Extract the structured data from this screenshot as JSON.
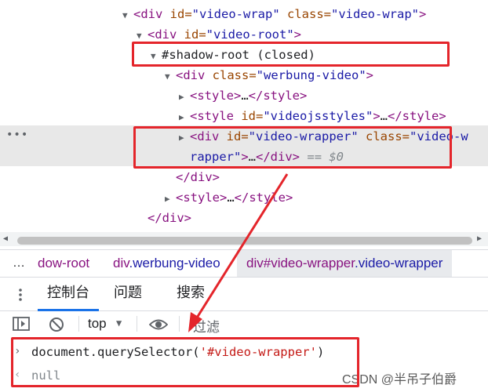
{
  "tree": {
    "l1": {
      "tag": "<div",
      "a1": "id=",
      "v1": "\"video-wrap\"",
      "a2": "class=",
      "v2": "\"video-wrap\"",
      "end": ">"
    },
    "l2": {
      "tag": "<div",
      "a1": "id=",
      "v1": "\"video-root\"",
      "end": ">"
    },
    "l3": {
      "text": "#shadow-root (closed)"
    },
    "l4": {
      "tag": "<div",
      "a1": "class=",
      "v1": "\"werbung-video\"",
      "end": ">"
    },
    "l5": {
      "tag": "<style>",
      "mid": "…",
      "close": "</style>"
    },
    "l6": {
      "tag": "<style",
      "a1": "id=",
      "v1": "\"videojsstyles\"",
      "end": ">",
      "mid": "…",
      "close": "</style>"
    },
    "l7": {
      "tag": "<div",
      "a1": "id=",
      "v1": "\"video-wrapper\"",
      "a2": "class=",
      "v2": "\"video-w"
    },
    "l8": {
      "v": "rapper\"",
      "end": ">",
      "mid": "…",
      "close": "</div>",
      "eq": "== $0"
    },
    "l9": {
      "close": "</div>"
    },
    "l10": {
      "tag": "<style>",
      "mid": "…",
      "close": "</style>"
    },
    "l11": {
      "close": "</div>"
    }
  },
  "breadcrumbs": {
    "more": "…",
    "c1": "dow-root",
    "c2_tag": "div",
    "c2_cls": ".werbung-video",
    "c3_tag": "div",
    "c3_id": "#video-wrapper",
    "c3_cls": ".video-wrapper"
  },
  "tabs": {
    "console": "控制台",
    "issues": "问题",
    "search": "搜索"
  },
  "toolbar": {
    "context": "top",
    "filter_placeholder": "过滤"
  },
  "console": {
    "input": "document.querySelector('#video-wrapper')",
    "input_fn": "document.querySelector(",
    "input_arg": "'#video-wrapper'",
    "input_end": ")",
    "output": "null",
    "watermark": "CSDN @半吊子伯爵"
  },
  "colors": {
    "highlight_box": "#e4252b",
    "arrow": "#e4252b",
    "tag": "#881280",
    "attr": "#994500",
    "value": "#1a1aa6"
  }
}
